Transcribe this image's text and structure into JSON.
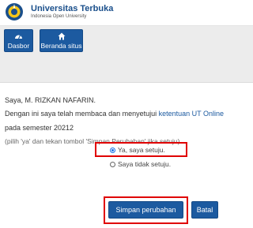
{
  "header": {
    "brand_name": "Universitas Terbuka",
    "brand_subtitle": "Indonesia Open University"
  },
  "nav": {
    "dasbor_label": "Dasbor",
    "beranda_label": "Beranda situs",
    "dasbor_icon": "dashboard-icon",
    "beranda_icon": "home-icon"
  },
  "content": {
    "greeting": "Saya, M. RIZKAN NAFARIN.",
    "statement_prefix": "Dengan ini saya telah membaca dan menyetujui",
    "terms_link": "ketentuan UT Online",
    "statement_suffix": "pada semester 20212",
    "instruction": "(pilih 'ya' dan tekan tombol 'Simpan Perubahan' jika setuju)"
  },
  "options": [
    {
      "label": "Ya, saya setuju.",
      "selected": true
    },
    {
      "label": "Saya tidak setuju.",
      "selected": false
    }
  ],
  "actions": {
    "save_label": "Simpan perubahan",
    "cancel_label": "Batal"
  },
  "colors": {
    "primary": "#1c5aa0",
    "brand_text": "#1a4f8b",
    "highlight": "#e00000",
    "nav_band": "#ececec"
  }
}
